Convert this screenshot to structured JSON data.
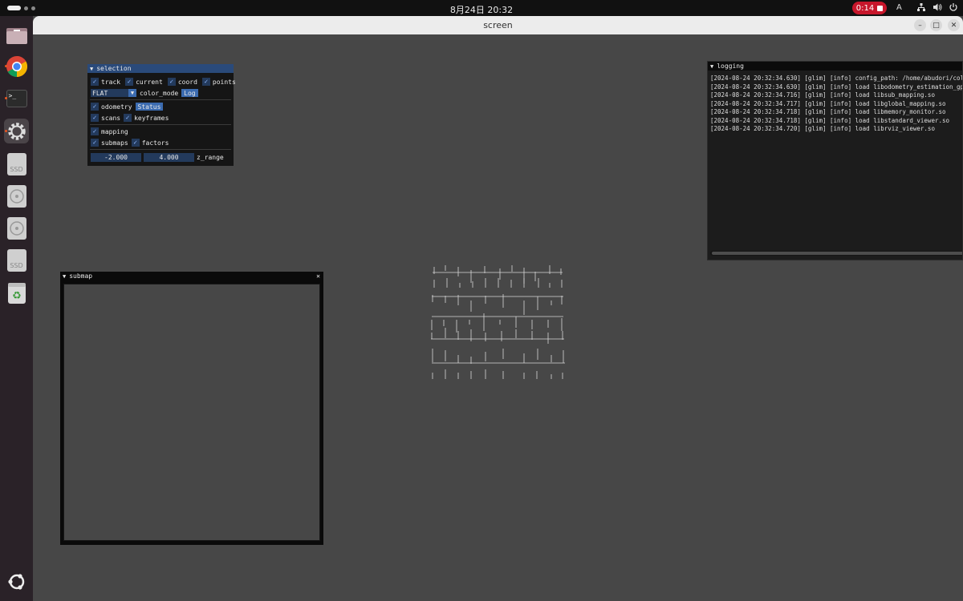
{
  "topbar": {
    "clock": "8月24日  20:32",
    "record_time": "0:14",
    "input_method": "A"
  },
  "dock": {
    "items": [
      {
        "name": "files",
        "icon": "folder-icon"
      },
      {
        "name": "chrome",
        "icon": "chrome-icon"
      },
      {
        "name": "terminal",
        "icon": "terminal-icon",
        "glyph": ">_"
      },
      {
        "name": "settings",
        "icon": "gear-icon"
      },
      {
        "name": "ssd1",
        "icon": "ssd-drive-icon",
        "label": "SSD"
      },
      {
        "name": "disc1",
        "icon": "disc-icon"
      },
      {
        "name": "disc2",
        "icon": "disc-icon"
      },
      {
        "name": "ssd2",
        "icon": "ssd-drive-icon",
        "label": "SSD"
      },
      {
        "name": "trash",
        "icon": "trash-icon"
      },
      {
        "name": "apps",
        "icon": "ubuntu-logo-icon"
      }
    ]
  },
  "window": {
    "title": "screen"
  },
  "selection": {
    "title": "selection",
    "row1": [
      "track",
      "current",
      "coord",
      "points"
    ],
    "color_mode_value": "FLAT",
    "color_mode_label": "color_mode",
    "log_button": "Log",
    "odometry_label": "odometry",
    "status_button": "Status",
    "scans_label": "scans",
    "keyframes_label": "keyframes",
    "mapping_label": "mapping",
    "submaps_label": "submaps",
    "factors_label": "factors",
    "z_min": "-2.000",
    "z_max": "4.000",
    "z_range_label": "z_range"
  },
  "logging": {
    "title": "logging",
    "lines": [
      "[2024-08-24 20:32:34.630] [glim] [info] config_path: /home/abudori/colco",
      "[2024-08-24 20:32:34.630] [glim] [info] load libodometry_estimation_gpu.",
      "[2024-08-24 20:32:34.716] [glim] [info] load libsub_mapping.so",
      "[2024-08-24 20:32:34.717] [glim] [info] load libglobal_mapping.so",
      "[2024-08-24 20:32:34.718] [glim] [info] load libmemory_monitor.so",
      "[2024-08-24 20:32:34.718] [glim] [info] load libstandard_viewer.so",
      "[2024-08-24 20:32:34.720] [glim] [info] load librviz_viewer.so"
    ]
  },
  "submap": {
    "title": "submap",
    "close": "✕"
  }
}
